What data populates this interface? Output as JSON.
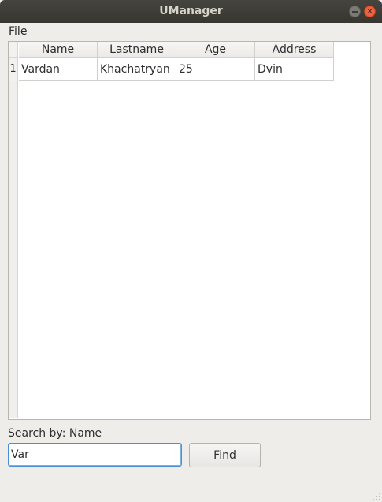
{
  "window": {
    "title": "UManager"
  },
  "menu": {
    "items": [
      "File"
    ]
  },
  "table": {
    "columns": [
      "Name",
      "Lastname",
      "Age",
      "Address"
    ],
    "rows": [
      {
        "row_number": "1",
        "cells": [
          "Vardan",
          "Khachatryan",
          "25",
          "Dvin"
        ]
      }
    ]
  },
  "search": {
    "label": "Search by: Name",
    "value": "Var",
    "button_label": "Find"
  },
  "colors": {
    "titlebar": "#3c3b37",
    "close_button": "#e95420",
    "focus_border": "#4a90d9"
  },
  "icons": {
    "minimize": "minimize-icon",
    "close": "close-icon"
  }
}
